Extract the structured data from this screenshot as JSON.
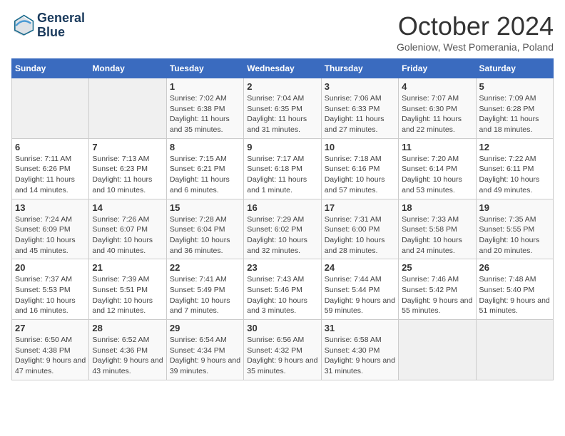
{
  "header": {
    "logo_line1": "General",
    "logo_line2": "Blue",
    "month_title": "October 2024",
    "subtitle": "Goleniow, West Pomerania, Poland"
  },
  "days_of_week": [
    "Sunday",
    "Monday",
    "Tuesday",
    "Wednesday",
    "Thursday",
    "Friday",
    "Saturday"
  ],
  "weeks": [
    [
      {
        "day": "",
        "info": ""
      },
      {
        "day": "",
        "info": ""
      },
      {
        "day": "1",
        "info": "Sunrise: 7:02 AM\nSunset: 6:38 PM\nDaylight: 11 hours and 35 minutes."
      },
      {
        "day": "2",
        "info": "Sunrise: 7:04 AM\nSunset: 6:35 PM\nDaylight: 11 hours and 31 minutes."
      },
      {
        "day": "3",
        "info": "Sunrise: 7:06 AM\nSunset: 6:33 PM\nDaylight: 11 hours and 27 minutes."
      },
      {
        "day": "4",
        "info": "Sunrise: 7:07 AM\nSunset: 6:30 PM\nDaylight: 11 hours and 22 minutes."
      },
      {
        "day": "5",
        "info": "Sunrise: 7:09 AM\nSunset: 6:28 PM\nDaylight: 11 hours and 18 minutes."
      }
    ],
    [
      {
        "day": "6",
        "info": "Sunrise: 7:11 AM\nSunset: 6:26 PM\nDaylight: 11 hours and 14 minutes."
      },
      {
        "day": "7",
        "info": "Sunrise: 7:13 AM\nSunset: 6:23 PM\nDaylight: 11 hours and 10 minutes."
      },
      {
        "day": "8",
        "info": "Sunrise: 7:15 AM\nSunset: 6:21 PM\nDaylight: 11 hours and 6 minutes."
      },
      {
        "day": "9",
        "info": "Sunrise: 7:17 AM\nSunset: 6:18 PM\nDaylight: 11 hours and 1 minute."
      },
      {
        "day": "10",
        "info": "Sunrise: 7:18 AM\nSunset: 6:16 PM\nDaylight: 10 hours and 57 minutes."
      },
      {
        "day": "11",
        "info": "Sunrise: 7:20 AM\nSunset: 6:14 PM\nDaylight: 10 hours and 53 minutes."
      },
      {
        "day": "12",
        "info": "Sunrise: 7:22 AM\nSunset: 6:11 PM\nDaylight: 10 hours and 49 minutes."
      }
    ],
    [
      {
        "day": "13",
        "info": "Sunrise: 7:24 AM\nSunset: 6:09 PM\nDaylight: 10 hours and 45 minutes."
      },
      {
        "day": "14",
        "info": "Sunrise: 7:26 AM\nSunset: 6:07 PM\nDaylight: 10 hours and 40 minutes."
      },
      {
        "day": "15",
        "info": "Sunrise: 7:28 AM\nSunset: 6:04 PM\nDaylight: 10 hours and 36 minutes."
      },
      {
        "day": "16",
        "info": "Sunrise: 7:29 AM\nSunset: 6:02 PM\nDaylight: 10 hours and 32 minutes."
      },
      {
        "day": "17",
        "info": "Sunrise: 7:31 AM\nSunset: 6:00 PM\nDaylight: 10 hours and 28 minutes."
      },
      {
        "day": "18",
        "info": "Sunrise: 7:33 AM\nSunset: 5:58 PM\nDaylight: 10 hours and 24 minutes."
      },
      {
        "day": "19",
        "info": "Sunrise: 7:35 AM\nSunset: 5:55 PM\nDaylight: 10 hours and 20 minutes."
      }
    ],
    [
      {
        "day": "20",
        "info": "Sunrise: 7:37 AM\nSunset: 5:53 PM\nDaylight: 10 hours and 16 minutes."
      },
      {
        "day": "21",
        "info": "Sunrise: 7:39 AM\nSunset: 5:51 PM\nDaylight: 10 hours and 12 minutes."
      },
      {
        "day": "22",
        "info": "Sunrise: 7:41 AM\nSunset: 5:49 PM\nDaylight: 10 hours and 7 minutes."
      },
      {
        "day": "23",
        "info": "Sunrise: 7:43 AM\nSunset: 5:46 PM\nDaylight: 10 hours and 3 minutes."
      },
      {
        "day": "24",
        "info": "Sunrise: 7:44 AM\nSunset: 5:44 PM\nDaylight: 9 hours and 59 minutes."
      },
      {
        "day": "25",
        "info": "Sunrise: 7:46 AM\nSunset: 5:42 PM\nDaylight: 9 hours and 55 minutes."
      },
      {
        "day": "26",
        "info": "Sunrise: 7:48 AM\nSunset: 5:40 PM\nDaylight: 9 hours and 51 minutes."
      }
    ],
    [
      {
        "day": "27",
        "info": "Sunrise: 6:50 AM\nSunset: 4:38 PM\nDaylight: 9 hours and 47 minutes."
      },
      {
        "day": "28",
        "info": "Sunrise: 6:52 AM\nSunset: 4:36 PM\nDaylight: 9 hours and 43 minutes."
      },
      {
        "day": "29",
        "info": "Sunrise: 6:54 AM\nSunset: 4:34 PM\nDaylight: 9 hours and 39 minutes."
      },
      {
        "day": "30",
        "info": "Sunrise: 6:56 AM\nSunset: 4:32 PM\nDaylight: 9 hours and 35 minutes."
      },
      {
        "day": "31",
        "info": "Sunrise: 6:58 AM\nSunset: 4:30 PM\nDaylight: 9 hours and 31 minutes."
      },
      {
        "day": "",
        "info": ""
      },
      {
        "day": "",
        "info": ""
      }
    ]
  ]
}
